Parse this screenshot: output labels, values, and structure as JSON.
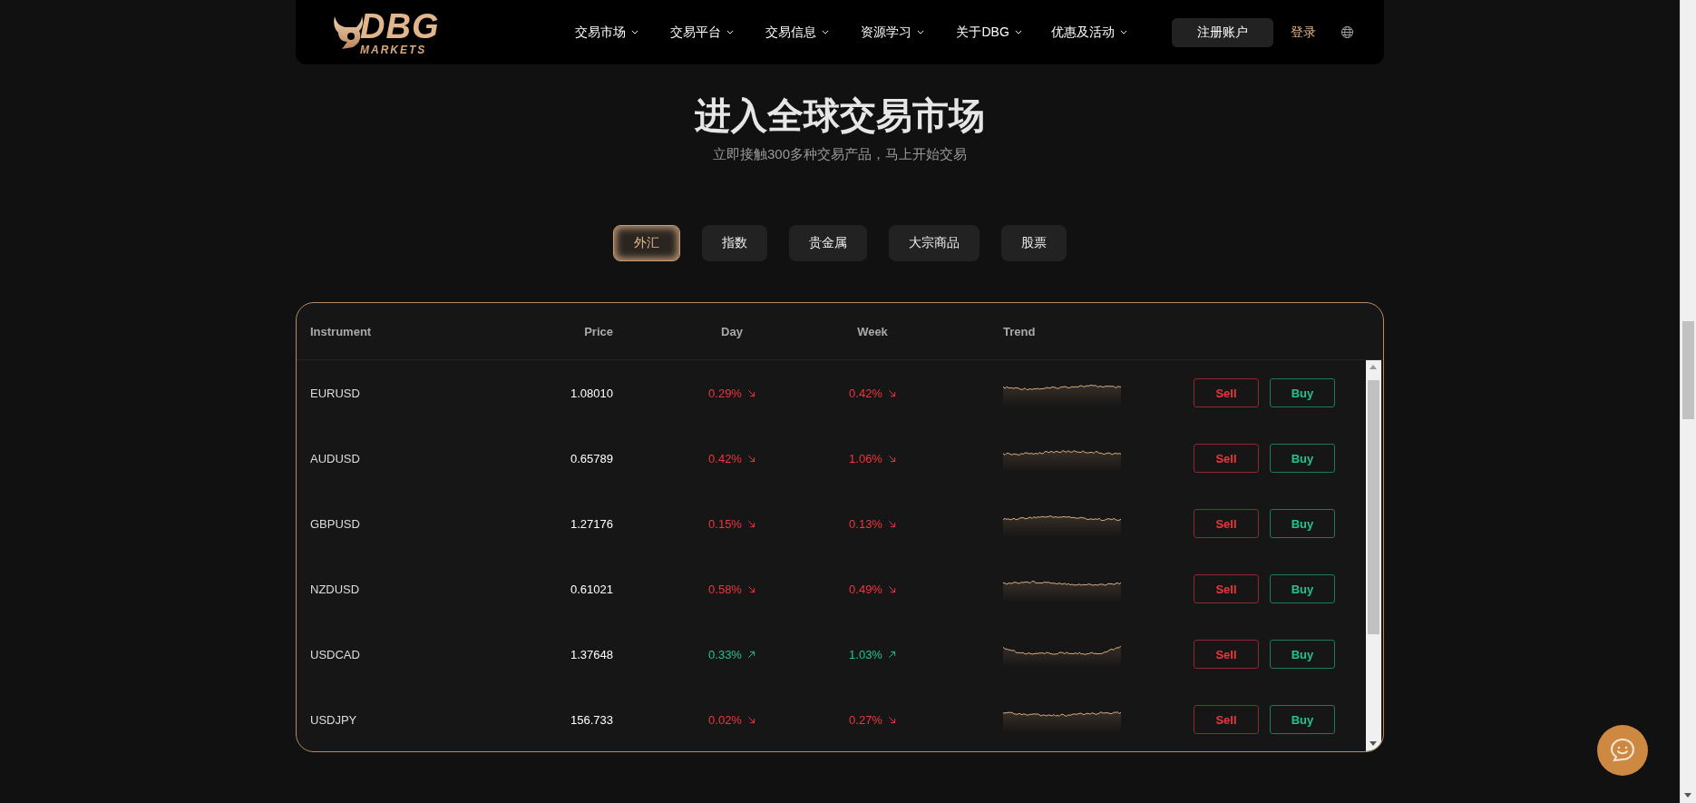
{
  "header": {
    "logo": {
      "brand": "DBG",
      "sub": "MARKETS"
    },
    "nav": [
      {
        "label": "交易市场"
      },
      {
        "label": "交易平台"
      },
      {
        "label": "交易信息"
      },
      {
        "label": "资源学习"
      },
      {
        "label": "关于DBG"
      },
      {
        "label": "优惠及活动"
      }
    ],
    "register": "注册账户",
    "login": "登录"
  },
  "hero": {
    "title": "进入全球交易市场",
    "subtitle": "立即接触300多种交易产品，马上开始交易"
  },
  "tabs": [
    {
      "label": "外汇",
      "selected": true
    },
    {
      "label": "指数",
      "selected": false
    },
    {
      "label": "贵金属",
      "selected": false
    },
    {
      "label": "大宗商品",
      "selected": false
    },
    {
      "label": "股票",
      "selected": false
    }
  ],
  "table": {
    "columns": [
      "Instrument",
      "Price",
      "Day",
      "Week",
      "Trend"
    ],
    "rows": [
      {
        "instrument": "EURUSD",
        "price": "1.08010",
        "day": {
          "value": "0.29%",
          "rising": false
        },
        "week": {
          "value": "0.42%",
          "rising": false
        },
        "sell": "Sell",
        "buy": "Buy"
      },
      {
        "instrument": "AUDUSD",
        "price": "0.65789",
        "day": {
          "value": "0.42%",
          "rising": false
        },
        "week": {
          "value": "1.06%",
          "rising": false
        },
        "sell": "Sell",
        "buy": "Buy"
      },
      {
        "instrument": "GBPUSD",
        "price": "1.27176",
        "day": {
          "value": "0.15%",
          "rising": false
        },
        "week": {
          "value": "0.13%",
          "rising": false
        },
        "sell": "Sell",
        "buy": "Buy"
      },
      {
        "instrument": "NZDUSD",
        "price": "0.61021",
        "day": {
          "value": "0.58%",
          "rising": false
        },
        "week": {
          "value": "0.49%",
          "rising": false
        },
        "sell": "Sell",
        "buy": "Buy"
      },
      {
        "instrument": "USDCAD",
        "price": "1.37648",
        "day": {
          "value": "0.33%",
          "rising": true
        },
        "week": {
          "value": "1.03%",
          "rising": true
        },
        "sell": "Sell",
        "buy": "Buy"
      },
      {
        "instrument": "USDJPY",
        "price": "156.733",
        "day": {
          "value": "0.02%",
          "rising": false
        },
        "week": {
          "value": "0.27%",
          "rising": false
        },
        "sell": "Sell",
        "buy": "Buy"
      }
    ]
  }
}
